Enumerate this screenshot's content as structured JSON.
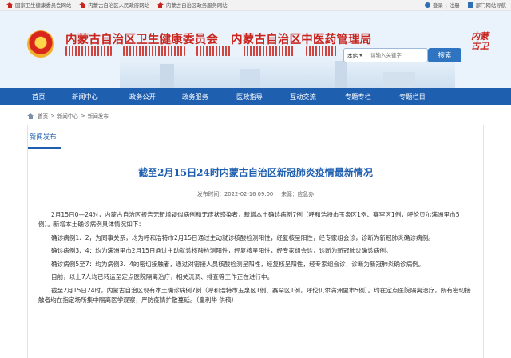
{
  "topbar": {
    "links": [
      "国家卫生健康委员会网站",
      "内蒙古自治区人民政府网站",
      "内蒙古自治区政务服务网站"
    ],
    "login": "登录",
    "register": "注册",
    "dept_portal": "部门网站导航"
  },
  "header": {
    "title_health": "内蒙古自治区卫生健康委员会",
    "title_tcm": "内蒙古自治区中医药管理局",
    "search_scope": "本站",
    "search_placeholder": "请输入关键字",
    "search_button": "搜索",
    "calligraphy": [
      "内蒙",
      "古卫"
    ]
  },
  "nav": {
    "items": [
      "首页",
      "新闻中心",
      "政务公开",
      "政务服务",
      "医政指导",
      "互动交流",
      "专题专栏",
      "专题栏目"
    ]
  },
  "breadcrumb": {
    "home": "首页",
    "sep": ">",
    "level1": "新闻中心",
    "level2": "新闻发布"
  },
  "section": {
    "label": "新闻发布"
  },
  "article": {
    "title": "截至2月15日24时内蒙古自治区新冠肺炎疫情最新情况",
    "published_label": "发布时间：",
    "published": "2022-02-16 09:00",
    "source_label": "来源：",
    "source": "应急办",
    "paragraphs": [
      "2月15日0—24时，内蒙古自治区报告无新增疑似病例和无症状感染者，新增本土确诊病例7例（呼和浩特市玉泉区1例、赛罕区1例，呼伦贝尔满洲里市5例）。新增本土确诊病例具体情况如下：",
      "确诊病例1、2，为同事关系，均为呼和浩特市2月15日通过主动就诊核酸检测阳性，经复核呈阳性，经专家组会诊，诊断为新冠肺炎确诊病例。",
      "确诊病例3、4：均为满洲里市2月15日通过主动就诊核酸检测阳性，经复核呈阳性，经专家组会诊，诊断为新冠肺炎确诊病例。",
      "确诊病例5至7：均为病例3、4的密切接触者，通过对密接人员核酸检测呈阳性，经复核呈阳性，经专家组会诊，诊断为新冠肺炎确诊病例。",
      "目前，以上7人均已转运至定点医院隔离治疗，相关流调、排查等工作正在进行中。",
      "截至2月15日24时，内蒙古自治区现有本土确诊病例7例（呼和浩特市玉泉区1例、赛罕区1例，呼伦贝尔满洲里市5例）。均在定点医院隔离治疗，所有密切接触者均在指定场所集中隔离医学观察，严防疫情扩散蔓延。（皇利华 供稿）"
    ]
  }
}
